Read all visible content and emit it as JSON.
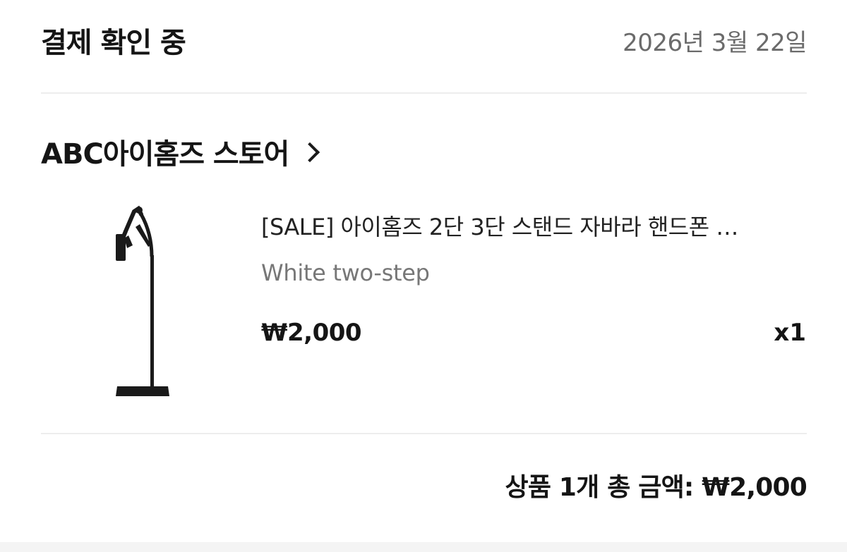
{
  "header": {
    "status": "결제 확인 중",
    "date": "2026년 3월 22일"
  },
  "store": {
    "name": "ABC아이홈즈 스토어"
  },
  "item": {
    "name": "[SALE] 아이홈즈 2단 3단 스탠드 자바라 핸드폰 …",
    "option": "White two-step",
    "price": "₩2,000",
    "quantity": "x1",
    "image_icon": "phone-stand-image"
  },
  "summary": {
    "total_text": "상품 1개 총 금액: ₩2,000"
  },
  "colors": {
    "text_primary": "#151515",
    "text_secondary": "#777777",
    "divider": "#ededed",
    "background": "#ffffff"
  }
}
